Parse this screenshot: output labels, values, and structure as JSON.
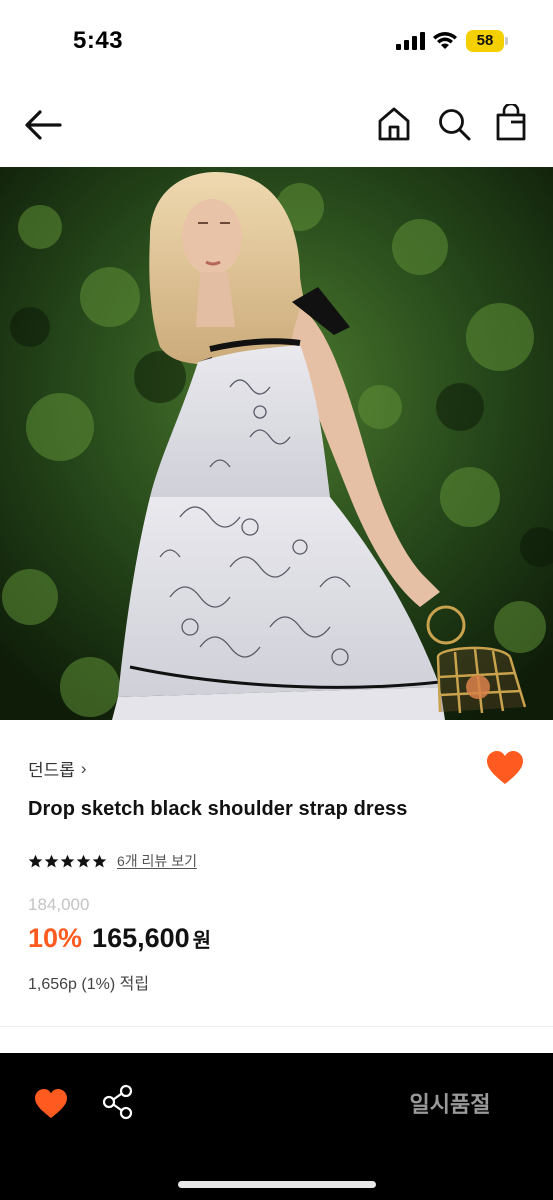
{
  "status_bar": {
    "time": "5:43",
    "battery_level": "58",
    "battery_color": "#f5d000"
  },
  "nav": {
    "icons": [
      "arrow-left-icon",
      "home-icon",
      "search-icon",
      "shopping-bag-icon"
    ]
  },
  "hero_image": {
    "description_icon": "product-photo"
  },
  "product": {
    "brand": "던드롭",
    "brand_chevron": "›",
    "title": "Drop sketch black shoulder strap dress",
    "rating_stars": 5,
    "review_link": "6개 리뷰 보기",
    "original_price": "184,000",
    "discount": "10%",
    "sale_price": "165,600",
    "currency": "원",
    "points": "1,656p (1%) 적립"
  },
  "bottom_bar": {
    "sold_out_label": "일시품절"
  },
  "colors": {
    "accent": "#ff5a1f",
    "wish_heart": "#ff5a1f",
    "bottom_bar_bg": "#000000"
  }
}
